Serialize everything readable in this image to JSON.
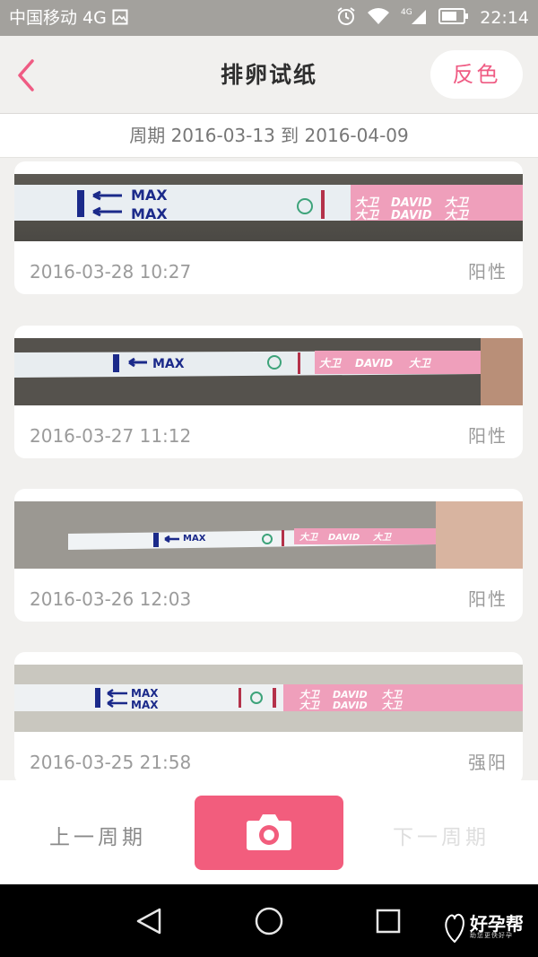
{
  "status_bar": {
    "carrier": "中国移动 4G",
    "network_badge": "4G",
    "time": "22:14",
    "icons": [
      "gallery-icon",
      "alarm-icon",
      "wifi-icon",
      "signal-icon",
      "battery-icon"
    ]
  },
  "nav": {
    "title": "排卵试纸",
    "invert_label": "反色",
    "back_icon": "chevron-left-icon"
  },
  "period_text": "周期 2016-03-13 到 2016-04-09",
  "records": [
    {
      "datetime": "2016-03-28 10:27",
      "result": "阳性"
    },
    {
      "datetime": "2016-03-27 11:12",
      "result": "阳性"
    },
    {
      "datetime": "2016-03-26 12:03",
      "result": "阳性"
    },
    {
      "datetime": "2016-03-25 21:58",
      "result": "强阳"
    }
  ],
  "strip_texts": {
    "max": "MAX",
    "brand": "DAVID",
    "brand_cn": "大卫"
  },
  "bottom": {
    "prev_label": "上一周期",
    "next_label": "下一周期",
    "camera_icon": "camera-icon"
  },
  "system_nav": {
    "icons": [
      "back-triangle-icon",
      "home-circle-icon",
      "recents-square-icon"
    ],
    "watermark_name": "好孕帮",
    "watermark_sub": "助您更快好孕"
  },
  "colors": {
    "accent": "#f25d7d",
    "status_bar": "#a3a19d",
    "background": "#f1f0ee"
  }
}
